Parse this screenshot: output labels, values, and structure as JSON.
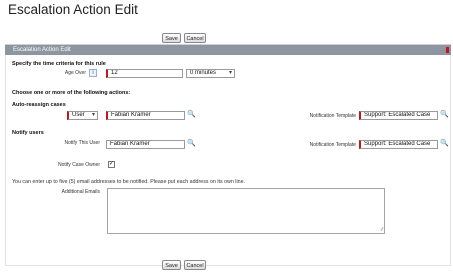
{
  "page": {
    "title": "Escalation Action Edit"
  },
  "buttons": {
    "save": "Save",
    "cancel": "Cancel"
  },
  "section": {
    "title": "Escalation Action Edit"
  },
  "time_criteria": {
    "heading": "Specify the time criteria for this rule",
    "age_over_label": "Age Over",
    "age_over_value": "12",
    "unit_value": "0 minutes"
  },
  "actions_heading": "Choose one or more of the following actions:",
  "auto_reassign": {
    "heading": "Auto-reassign cases",
    "type_value": "User",
    "assignee_value": "Fabian Kramer",
    "template_label": "Notification Template",
    "template_value": "Support: Escalated Case"
  },
  "notify": {
    "heading": "Notify users",
    "user_label": "Notify This User",
    "user_value": "Fabian Kramer",
    "template_label": "Notification Template",
    "template_value": "Support: Escalated Case",
    "owner_label": "Notify Case Owner",
    "owner_checked": "✓"
  },
  "emails": {
    "note": "You can enter up to five (5) email addresses to be notified. Please put each address on its own line.",
    "label": "Additional Emails"
  },
  "icons": {
    "info": "i",
    "lookup": "🔍",
    "resize": "⁄⁄"
  },
  "colors": {
    "header_bg": "#8d95a1",
    "required": "#c3161c"
  }
}
